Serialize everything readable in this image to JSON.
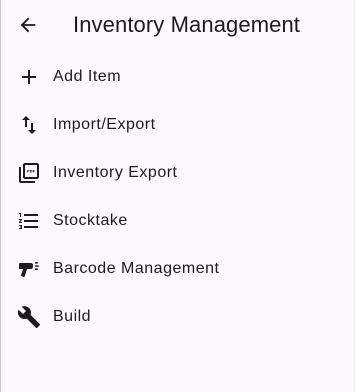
{
  "appbar": {
    "back_icon": "arrow-back-icon",
    "title": "Inventory Management"
  },
  "menu": {
    "items": [
      {
        "label": "Add Item",
        "icon": "add-icon"
      },
      {
        "label": "Import/Export",
        "icon": "import-export-icon"
      },
      {
        "label": "Inventory Export",
        "icon": "picture-as-pdf-icon"
      },
      {
        "label": "Stocktake",
        "icon": "format-list-numbered-icon"
      },
      {
        "label": "Barcode Management",
        "icon": "barcode-scanner-icon"
      },
      {
        "label": "Build",
        "icon": "build-icon"
      }
    ]
  },
  "colors": {
    "background": "#FCF8FC",
    "text": "#1C1B1F",
    "icon": "#1C1B1F"
  }
}
